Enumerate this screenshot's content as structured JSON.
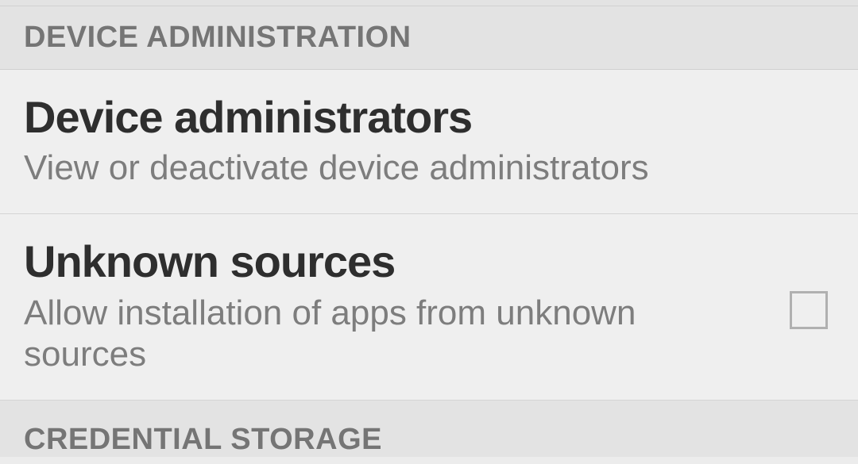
{
  "sections": {
    "device_admin": {
      "header": "DEVICE ADMINISTRATION",
      "items": [
        {
          "title": "Device administrators",
          "subtitle": "View or deactivate device administrators"
        },
        {
          "title": "Unknown sources",
          "subtitle": "Allow installation of apps from unknown sources",
          "checked": false
        }
      ]
    },
    "credential_storage": {
      "header": "CREDENTIAL STORAGE"
    }
  }
}
